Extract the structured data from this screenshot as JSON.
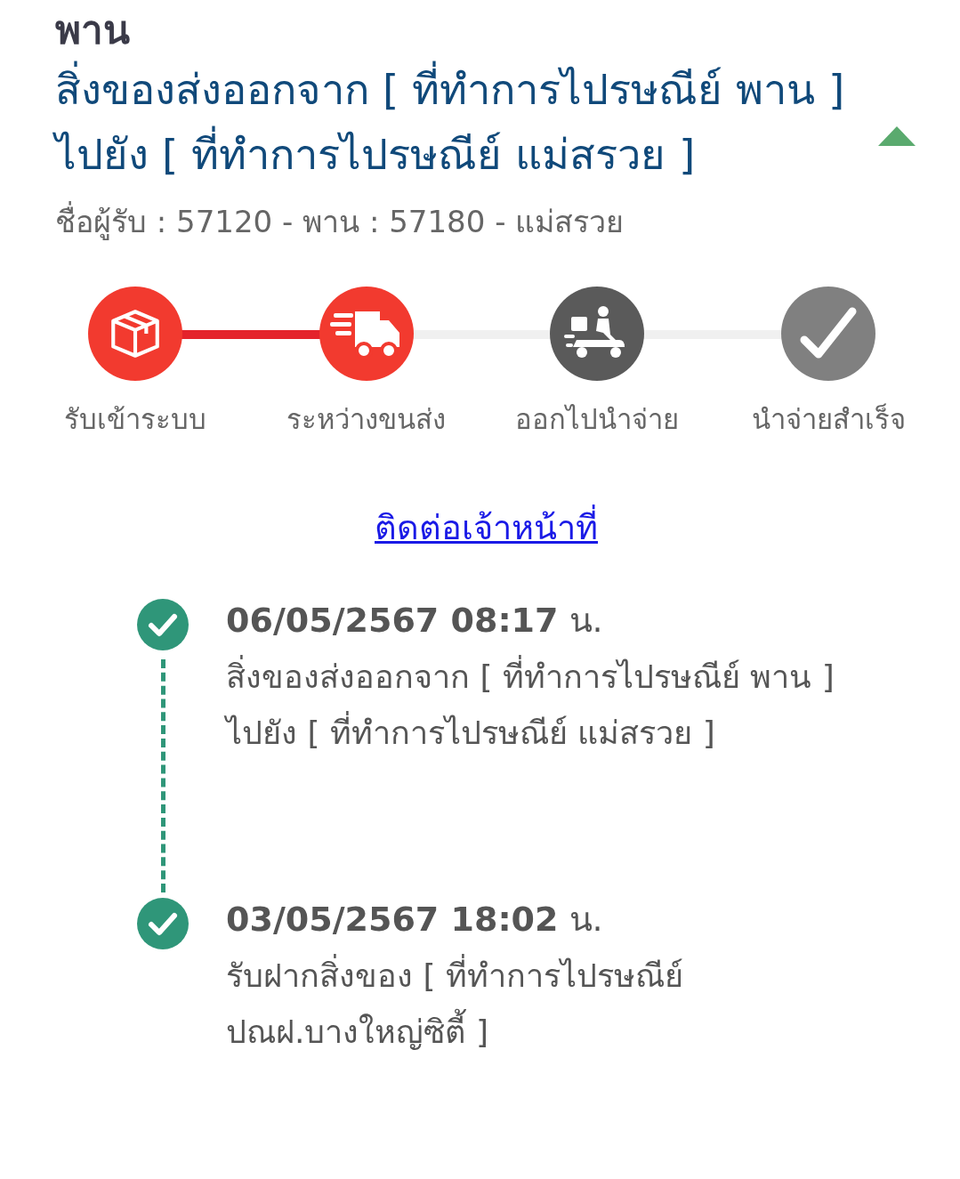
{
  "header": {
    "branch": "พาน",
    "status_title": "สิ่งของส่งออกจาก [ ที่ทำการไปรษณีย์ พาน ] ไปยัง [ ที่ทำการไปรษณีย์ แม่สรวย ]",
    "expanded": true,
    "route": "ชื่อผู้รับ : 57120 - พาน : 57180 - แม่สรวย"
  },
  "steps": [
    {
      "kind": "box",
      "label": "รับเข้าระบบ",
      "color": "#f23a2f"
    },
    {
      "kind": "truck",
      "label": "ระหว่างขนส่ง",
      "color": "#f23a2f"
    },
    {
      "kind": "scooter",
      "label": "ออกไปนำจ่าย",
      "color": "#5a5a5a"
    },
    {
      "kind": "check",
      "label": "นำจ่ายสำเร็จ",
      "color": "#808080"
    }
  ],
  "connectors": [
    {
      "reached": true
    },
    {
      "reached": false
    },
    {
      "reached": false
    }
  ],
  "contact_link": "ติดต่อเจ้าหน้าที่",
  "events": [
    {
      "time": "**06/05/2567 08:17** น.",
      "description": "สิ่งของส่งออกจาก [ ที่ทำการไปรษณีย์ พาน ] ไปยัง [ ที่ทำการไปรษณีย์ แม่สรวย ]"
    },
    {
      "time": "**03/05/2567 18:02** น.",
      "description": "รับฝากสิ่งของ [ ที่ทำการไปรษณีย์ ปณฝ.บางใหญ่ซิตี้ ]"
    }
  ]
}
